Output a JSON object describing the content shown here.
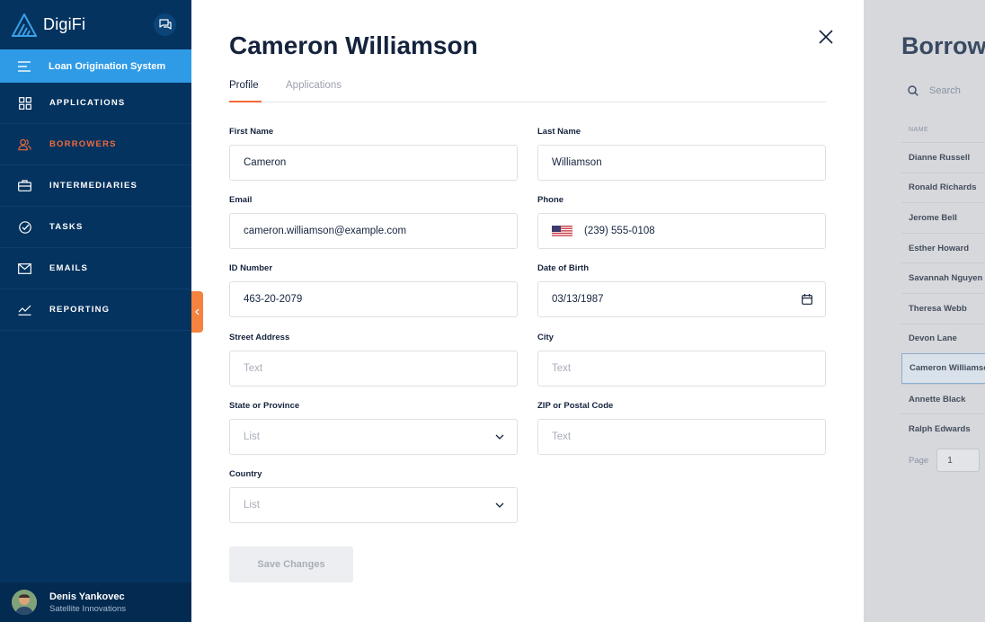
{
  "sidebar": {
    "brand": "DigiFi",
    "los_label": "Loan Origination System",
    "items": [
      {
        "label": "APPLICATIONS"
      },
      {
        "label": "BORROWERS"
      },
      {
        "label": "INTERMEDIARIES"
      },
      {
        "label": "TASKS"
      },
      {
        "label": "EMAILS"
      },
      {
        "label": "REPORTING"
      }
    ],
    "active_item": "BORROWERS",
    "user": {
      "name": "Denis Yankovec",
      "org": "Satellite Innovations"
    }
  },
  "panel": {
    "title": "Cameron Williamson",
    "tabs": [
      {
        "label": "Profile"
      },
      {
        "label": "Applications"
      }
    ],
    "active_tab": "Profile",
    "fields": {
      "first_name": {
        "label": "First Name",
        "value": "Cameron"
      },
      "last_name": {
        "label": "Last Name",
        "value": "Williamson"
      },
      "email": {
        "label": "Email",
        "value": "cameron.williamson@example.com"
      },
      "phone": {
        "label": "Phone",
        "value": "(239) 555-0108"
      },
      "id_number": {
        "label": "ID Number",
        "value": "463-20-2079"
      },
      "dob": {
        "label": "Date of Birth",
        "value": "03/13/1987"
      },
      "street": {
        "label": "Street Address",
        "placeholder": "Text"
      },
      "city": {
        "label": "City",
        "placeholder": "Text"
      },
      "state": {
        "label": "State or Province",
        "placeholder": "List"
      },
      "zip": {
        "label": "ZIP or Postal Code",
        "placeholder": "Text"
      },
      "country": {
        "label": "Country",
        "placeholder": "List"
      }
    },
    "save_label": "Save Changes"
  },
  "background_list": {
    "title": "Borrowers",
    "search_placeholder": "Search",
    "column_header": "NAME",
    "rows": [
      "Dianne Russell",
      "Ronald Richards",
      "Jerome Bell",
      "Esther Howard",
      "Savannah Nguyen",
      "Theresa Webb",
      "Devon Lane",
      "Cameron Williamson",
      "Annette Black",
      "Ralph Edwards"
    ],
    "selected_row": "Cameron Williamson",
    "page_label": "Page",
    "page_value": "1"
  },
  "colors": {
    "sidebar_bg": "#05335f",
    "accent_orange": "#f16a3a",
    "los_blue": "#2f9be6"
  }
}
